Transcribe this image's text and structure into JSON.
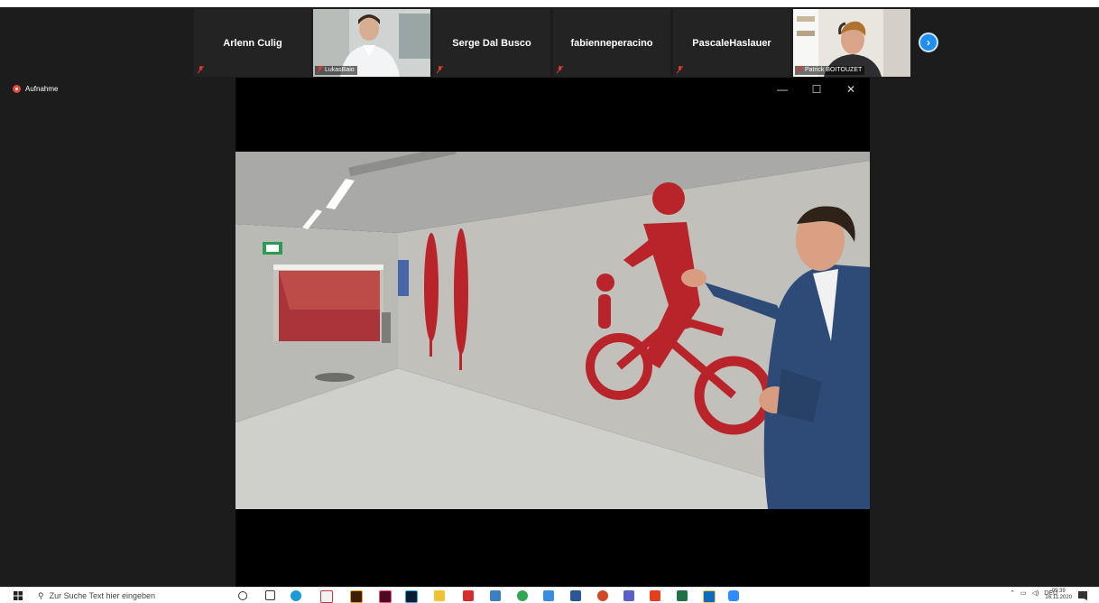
{
  "participants": [
    {
      "name": "Arlenn Culig",
      "has_video": false
    },
    {
      "name": "LukasBaio",
      "has_video": true
    },
    {
      "name": "Serge Dal Busco",
      "has_video": false
    },
    {
      "name": "fabienneperacino",
      "has_video": false
    },
    {
      "name": "PascaleHaslauer",
      "has_video": false
    },
    {
      "name": "Patrick BOITOUZET",
      "has_video": true
    }
  ],
  "next_page_icon": "chevron-right-icon",
  "recording": {
    "label": "Aufnahme"
  },
  "video_window": {
    "controls": {
      "minimize": "—",
      "maximize": "☐",
      "close": "✕"
    }
  },
  "taskbar": {
    "search_placeholder": "Zur Suche Text hier eingeben",
    "language": "DEU",
    "time": "09:39",
    "date": "16.11.2020",
    "pinned_icons": [
      "cortana-icon",
      "task-view-icon",
      "edge-icon",
      "acrobat-reader-icon",
      "illustrator-icon",
      "indesign-icon",
      "photoshop-icon",
      "file-explorer-icon",
      "acrobat-icon",
      "snipping-icon",
      "chrome-icon",
      "remote-desktop-icon",
      "word-icon",
      "powerpoint-icon",
      "teams-icon",
      "office-icon",
      "excel-icon",
      "outlook-icon",
      "zoom-icon"
    ]
  },
  "colors": {
    "zoom_bg": "#1c1c1c",
    "accent_blue": "#1f8ff0",
    "record_red": "#e04a3a",
    "bike_red": "#b8242a"
  }
}
